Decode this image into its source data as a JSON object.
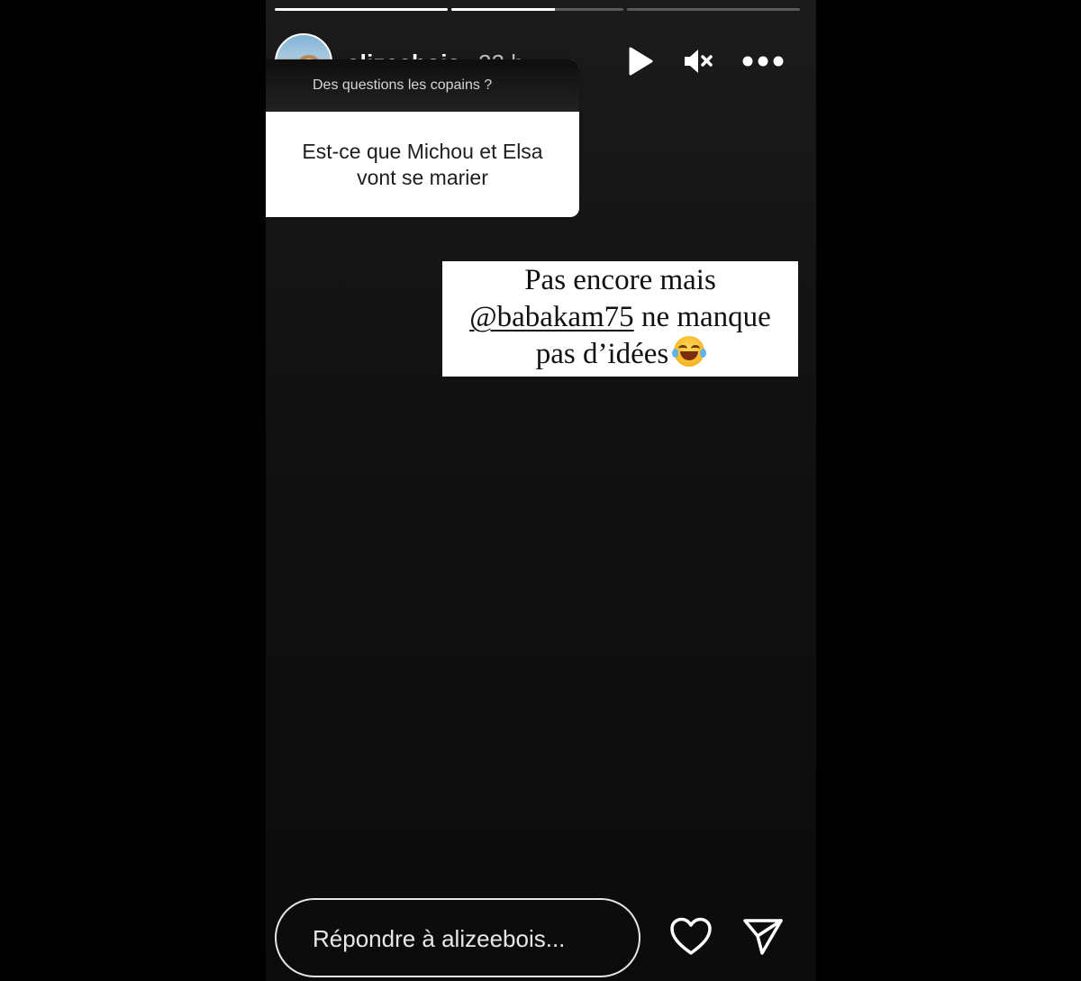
{
  "story": {
    "progress": [
      1,
      0.6,
      0
    ],
    "header": {
      "username": "alizeebois",
      "time_ago": "22 h",
      "icons": [
        "avatar",
        "play-icon",
        "mute-icon",
        "more-icon"
      ]
    },
    "question_sticker": {
      "prompt": "Des questions les copains ?",
      "question_line1": "Est-ce que Michou et Elsa",
      "question_line2": "vont se marier"
    },
    "answer": {
      "line1": "Pas encore mais",
      "mention": "@babakam75",
      "line2_rest": " ne manque",
      "line3": "pas d’idées"
    },
    "footer": {
      "reply_placeholder": "Répondre à alizeebois...",
      "icons": [
        "heart-icon",
        "send-icon"
      ]
    },
    "colors": {
      "background": "#000000",
      "story_bg": "#141414",
      "text_primary": "#ffffff",
      "text_secondary": "#bdbdbd"
    }
  }
}
